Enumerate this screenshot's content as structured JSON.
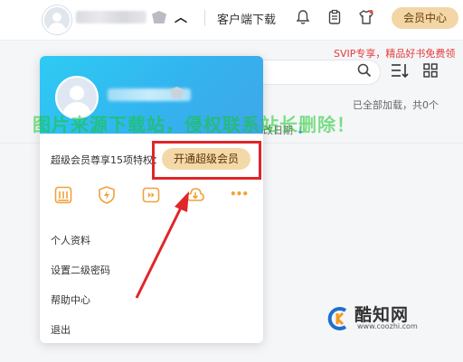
{
  "topbar": {
    "client_download": "客户端下载",
    "vip_center": "会员中心"
  },
  "promo": "SVIP专享，精品好书免费领",
  "main": {
    "loaded_text": "已全部加载，共0个",
    "date_column": "改日期",
    "date_sort_arrow": "↓"
  },
  "watermark": "图片来源下载站，侵权联系站长删除！",
  "panel": {
    "benefit_text": "超级会员尊享15项特权：",
    "open_vip_button": "开通超级会员",
    "menu": [
      {
        "label": "个人资料"
      },
      {
        "label": "设置二级密码"
      },
      {
        "label": "帮助中心"
      },
      {
        "label": "退出"
      }
    ],
    "more_icon": "•••"
  },
  "brand": {
    "name": "酷知网",
    "url": "www.coozhi.com"
  },
  "colors": {
    "accent_blue": "#33b4ef",
    "vip_gold": "#f4d9a8",
    "highlight_red": "#e0262a",
    "promo_red": "#e23b3b"
  }
}
